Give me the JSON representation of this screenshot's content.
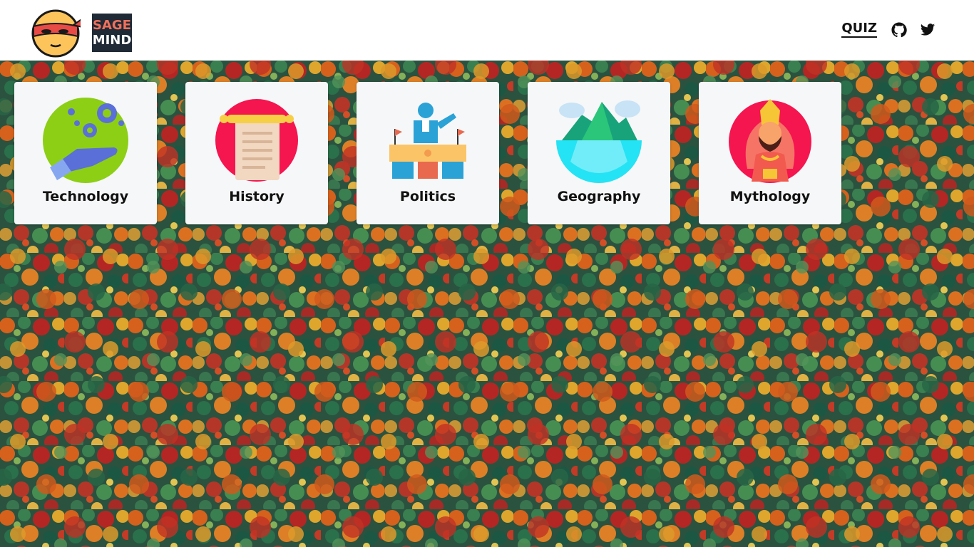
{
  "brand": {
    "logo_icon": "ninja-face-icon",
    "word_top": "SAGE",
    "word_bottom": "MIND",
    "accent_color": "#f0705a",
    "dark_color": "#1f2a36"
  },
  "nav": {
    "quiz_label": "QUIZ",
    "github_icon": "github-icon",
    "twitter_icon": "twitter-icon"
  },
  "background": {
    "description_icon": "autumn-forest-aerial-image"
  },
  "categories": [
    {
      "label": "Technology",
      "icon": "tech-hand-gears-icon"
    },
    {
      "label": "History",
      "icon": "scroll-icon"
    },
    {
      "label": "Politics",
      "icon": "podium-speaker-icon"
    },
    {
      "label": "Geography",
      "icon": "globe-mountains-icon"
    },
    {
      "label": "Mythology",
      "icon": "deity-icon"
    }
  ]
}
